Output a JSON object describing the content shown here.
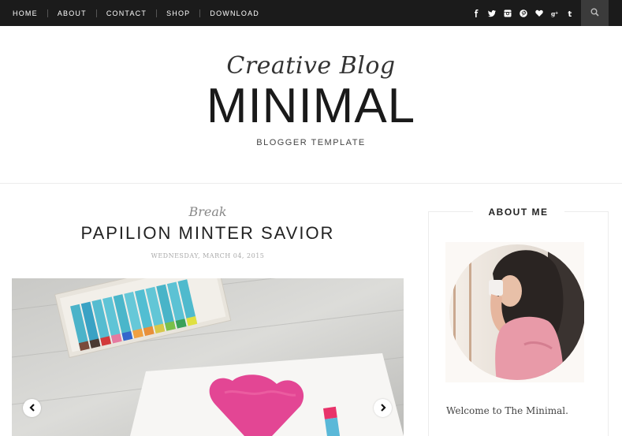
{
  "nav": {
    "items": [
      "HOME",
      "ABOUT",
      "CONTACT",
      "SHOP",
      "DOWNLOAD"
    ]
  },
  "social": {
    "icons": [
      "facebook-icon",
      "twitter-icon",
      "instagram-icon",
      "pinterest-icon",
      "heart-icon",
      "google-plus-icon",
      "tumblr-icon"
    ]
  },
  "header": {
    "tagline": "Creative Blog",
    "title": "MINIMAL",
    "subtitle": "BLOGGER TEMPLATE"
  },
  "post": {
    "category": "Break",
    "title": "PAPILION MINTER SAVIOR",
    "date": "WEDNESDAY, MARCH 04, 2015"
  },
  "sidebar": {
    "widget_title": "ABOUT ME",
    "about_text": "Welcome to The Minimal."
  },
  "colors": {
    "topbar": "#1b1b1b",
    "search_button": "#3b3b3b",
    "heart_pink": "#e0338a",
    "shirt_pink": "#e89aa8"
  }
}
